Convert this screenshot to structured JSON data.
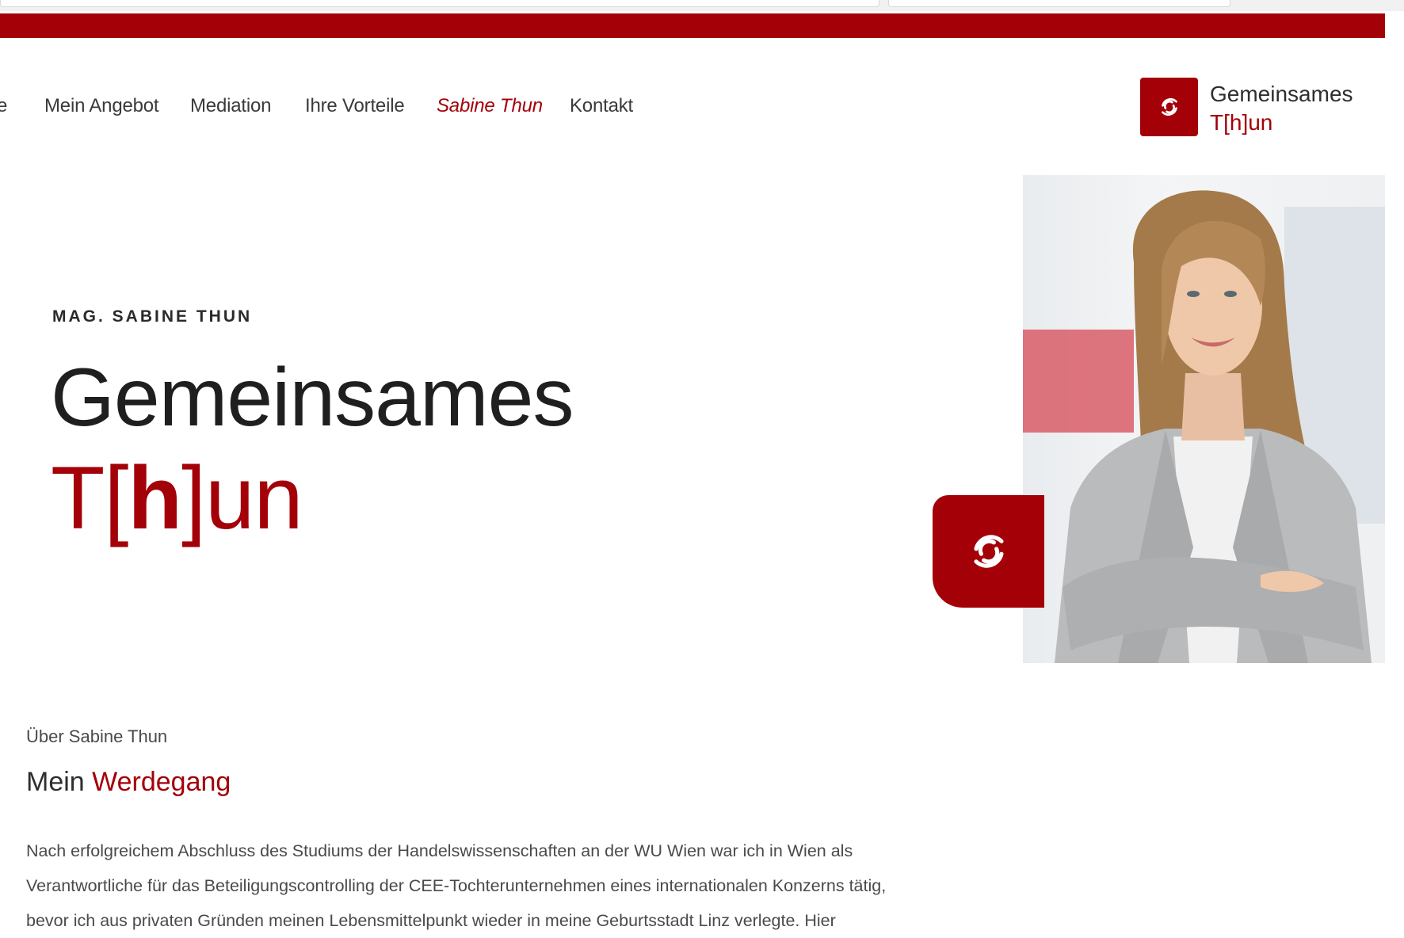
{
  "nav": {
    "partial_item": "e",
    "items": [
      {
        "label": "Mein Angebot"
      },
      {
        "label": "Mediation"
      },
      {
        "label": "Ihre Vorteile"
      },
      {
        "label": "Sabine Thun"
      },
      {
        "label": "Kontakt"
      }
    ],
    "active_index": 3
  },
  "brand": {
    "line1": "Gemeinsames",
    "line2": "T[h]un",
    "logo_icon": "swirl-icon"
  },
  "hero": {
    "eyebrow": "MAG. SABINE THUN",
    "title_line1": "Gemeinsames",
    "title_line2_a": "T[",
    "title_line2_b": "h",
    "title_line2_c": "]un"
  },
  "about": {
    "kicker": "Über Sabine Thun",
    "title_plain": "Mein",
    "title_accent": "Werdegang",
    "paragraph_lines": [
      "Nach erfolgreichem Abschluss des Studiums der Handelswissenschaften an der WU Wien war ich in Wien als",
      "Verantwortliche für das Beteiligungscontrolling der CEE-Tochterunternehmen eines internationalen Konzerns tätig,",
      "bevor ich aus privaten Gründen meinen Lebensmittelpunkt wieder in meine Geburtsstadt Linz verlegte. Hier"
    ]
  },
  "colors": {
    "accent": "#a30008",
    "text": "#333333"
  }
}
